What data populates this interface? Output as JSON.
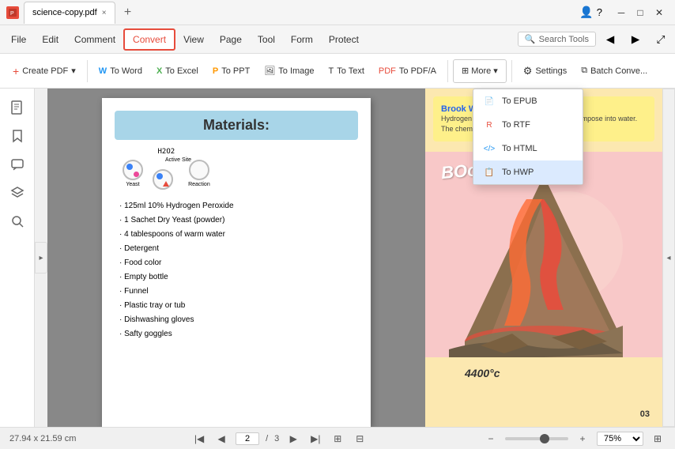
{
  "titleBar": {
    "tabTitle": "science-copy.pdf",
    "closeTabLabel": "×",
    "addTabLabel": "+",
    "minBtn": "—",
    "maxBtn": "□",
    "closeBtn": "×",
    "profileIcon": "👤",
    "helpIcon": "?"
  },
  "menuBar": {
    "items": [
      "File",
      "Edit",
      "Comment",
      "Convert",
      "View",
      "Page",
      "Tool",
      "Form",
      "Protect"
    ],
    "activeItem": "Convert",
    "searchPlaceholder": "Search Tools",
    "navBackLabel": "◀",
    "navFwdLabel": "▶",
    "expandLabel": "⤢"
  },
  "toolbar": {
    "createPDF": "Create PDF",
    "toWord": "To Word",
    "toExcel": "To Excel",
    "toPPT": "To PPT",
    "toImage": "To Image",
    "toText": "To Text",
    "toPDFA": "To PDF/A",
    "moreLabel": "More",
    "settings": "Settings",
    "batchConvert": "Batch Conve..."
  },
  "dropdown": {
    "items": [
      {
        "label": "To EPUB",
        "icon": "📄"
      },
      {
        "label": "To RTF",
        "icon": "📝"
      },
      {
        "label": "To HTML",
        "icon": "🌐"
      },
      {
        "label": "To HWP",
        "icon": "📋"
      }
    ],
    "highlightedIndex": 3
  },
  "pdfPage": {
    "header": "Materials:",
    "h2o2Label": "H2O2",
    "activeSiteLabel": "Active Site",
    "yeastLabel": "Yeast",
    "reactionLabel": "Reaction",
    "materials": [
      "125ml 10% Hydrogen Peroxide",
      "1 Sachet Dry Yeast (powder)",
      "4 tablespoons of warm water",
      "Detergent",
      "Food color",
      "Empty bottle",
      "Funnel",
      "Plastic tray or tub",
      "Dishwashing gloves",
      "Safty goggles"
    ],
    "booText": "BOoooh!",
    "tempText": "4400°c",
    "pageNumber": "03"
  },
  "rightPanel": {
    "authorName": "Brook Wells",
    "cardText": "Hydrogen peroxide molecules naturally decompose into water. The chemical equation for this"
  },
  "statusBar": {
    "dimensions": "27.94 x 21.59 cm",
    "currentPage": "2",
    "totalPages": "3",
    "zoomOut": "−",
    "zoomIn": "+",
    "zoomLevel": "75%",
    "fitLabel": "⊞"
  }
}
